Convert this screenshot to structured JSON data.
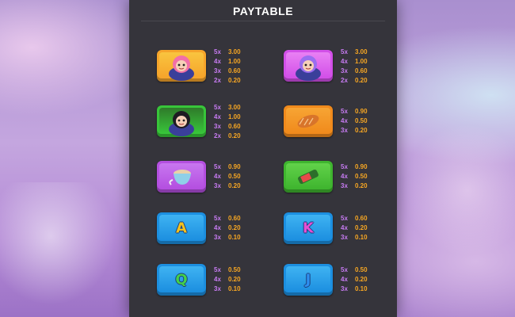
{
  "title": "PAYTABLE",
  "colors": {
    "panel": "#35343b",
    "multiplier": "#c77bf2",
    "payout": "#f6a623"
  },
  "symbols": [
    {
      "id": "girl-pink",
      "icon": "pink-haired-girl-icon",
      "frame": "#f6a52b",
      "face": "#f9c53f",
      "pays": [
        {
          "m": "5x",
          "v": "3.00"
        },
        {
          "m": "4x",
          "v": "1.00"
        },
        {
          "m": "3x",
          "v": "0.60"
        },
        {
          "m": "2x",
          "v": "0.20"
        }
      ]
    },
    {
      "id": "girl-purple",
      "icon": "purple-haired-girl-icon",
      "frame": "#d24fe8",
      "face": "#e981f4",
      "pays": [
        {
          "m": "5x",
          "v": "3.00"
        },
        {
          "m": "4x",
          "v": "1.00"
        },
        {
          "m": "3x",
          "v": "0.60"
        },
        {
          "m": "2x",
          "v": "0.20"
        }
      ]
    },
    {
      "id": "girl-green",
      "icon": "dark-haired-girl-icon",
      "frame": "#38c53a",
      "face": "#2f7a2a",
      "pays": [
        {
          "m": "5x",
          "v": "3.00"
        },
        {
          "m": "4x",
          "v": "1.00"
        },
        {
          "m": "3x",
          "v": "0.60"
        },
        {
          "m": "2x",
          "v": "0.20"
        }
      ]
    },
    {
      "id": "corn-dog",
      "icon": "corn-dog-icon",
      "frame": "#f08a1c",
      "face": "#f7a534",
      "pays": [
        {
          "m": "5x",
          "v": "0.90"
        },
        {
          "m": "4x",
          "v": "0.50"
        },
        {
          "m": "3x",
          "v": "0.20"
        }
      ]
    },
    {
      "id": "latte",
      "icon": "coffee-cup-icon",
      "frame": "#b44fe0",
      "face": "#c877f0",
      "pays": [
        {
          "m": "5x",
          "v": "0.90"
        },
        {
          "m": "4x",
          "v": "0.50"
        },
        {
          "m": "3x",
          "v": "0.20"
        }
      ]
    },
    {
      "id": "soda",
      "icon": "soda-bottle-icon",
      "frame": "#3fb52f",
      "face": "#62d24a",
      "pays": [
        {
          "m": "5x",
          "v": "0.90"
        },
        {
          "m": "4x",
          "v": "0.50"
        },
        {
          "m": "3x",
          "v": "0.20"
        }
      ]
    },
    {
      "id": "letter-a",
      "icon": "letter-a-icon",
      "glyph": "A",
      "glyph_color": "#f4c21e",
      "frame": "#1c8fe0",
      "face": "#3fb3f2",
      "pays": [
        {
          "m": "5x",
          "v": "0.60"
        },
        {
          "m": "4x",
          "v": "0.20"
        },
        {
          "m": "3x",
          "v": "0.10"
        }
      ]
    },
    {
      "id": "letter-k",
      "icon": "letter-k-icon",
      "glyph": "K",
      "glyph_color": "#e64fd2",
      "frame": "#1c8fe0",
      "face": "#3fb3f2",
      "pays": [
        {
          "m": "5x",
          "v": "0.60"
        },
        {
          "m": "4x",
          "v": "0.20"
        },
        {
          "m": "3x",
          "v": "0.10"
        }
      ]
    },
    {
      "id": "letter-q",
      "icon": "letter-q-icon",
      "glyph": "Q",
      "glyph_color": "#44d04a",
      "frame": "#1c8fe0",
      "face": "#3fb3f2",
      "pays": [
        {
          "m": "5x",
          "v": "0.50"
        },
        {
          "m": "4x",
          "v": "0.20"
        },
        {
          "m": "3x",
          "v": "0.10"
        }
      ]
    },
    {
      "id": "letter-j",
      "icon": "letter-j-icon",
      "glyph": "J",
      "glyph_color": "#2e8ff0",
      "frame": "#1c8fe0",
      "face": "#3fb3f2",
      "pays": [
        {
          "m": "5x",
          "v": "0.50"
        },
        {
          "m": "4x",
          "v": "0.20"
        },
        {
          "m": "3x",
          "v": "0.10"
        }
      ]
    }
  ]
}
